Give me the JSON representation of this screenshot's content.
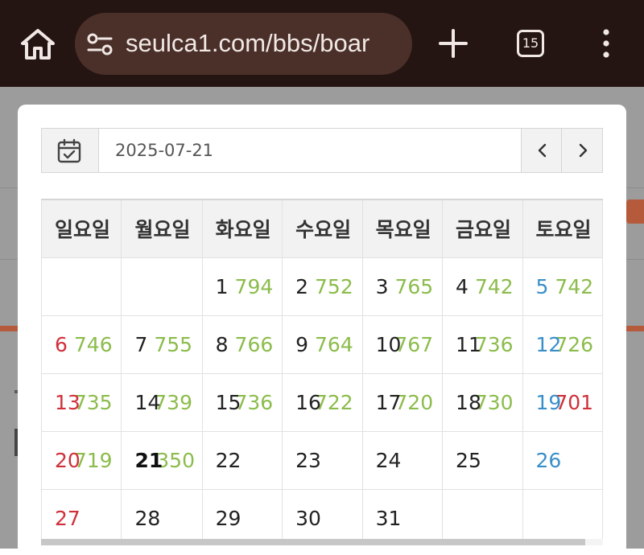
{
  "browser": {
    "url": "seulca1.com/bbs/boar",
    "tab_count": "15",
    "icons": {
      "home": "home-icon",
      "site_info": "site-info-icon",
      "new_tab": "plus-icon",
      "menu": "more-vertical-icon"
    },
    "colors": {
      "bar_bg": "#251512",
      "url_bg": "#4b302a",
      "fg": "#f1e8e5"
    }
  },
  "picker": {
    "date_value": "2025-07-21",
    "icons": {
      "calendar": "calendar-check-icon",
      "prev": "chevron-left-icon",
      "next": "chevron-right-icon"
    }
  },
  "calendar": {
    "weekdays": [
      "일요일",
      "월요일",
      "화요일",
      "수요일",
      "목요일",
      "금요일",
      "토요일"
    ],
    "weeks": [
      [
        {
          "day": "",
          "value": ""
        },
        {
          "day": "",
          "value": ""
        },
        {
          "day": "1",
          "value": "794"
        },
        {
          "day": "2",
          "value": "752"
        },
        {
          "day": "3",
          "value": "765"
        },
        {
          "day": "4",
          "value": "742"
        },
        {
          "day": "5",
          "value": "742"
        }
      ],
      [
        {
          "day": "6",
          "value": "746"
        },
        {
          "day": "7",
          "value": "755"
        },
        {
          "day": "8",
          "value": "766"
        },
        {
          "day": "9",
          "value": "764"
        },
        {
          "day": "10",
          "value": "767"
        },
        {
          "day": "11",
          "value": "736"
        },
        {
          "day": "12",
          "value": "726"
        }
      ],
      [
        {
          "day": "13",
          "value": "735"
        },
        {
          "day": "14",
          "value": "739"
        },
        {
          "day": "15",
          "value": "736"
        },
        {
          "day": "16",
          "value": "722"
        },
        {
          "day": "17",
          "value": "720"
        },
        {
          "day": "18",
          "value": "730"
        },
        {
          "day": "19",
          "value": "701"
        }
      ],
      [
        {
          "day": "20",
          "value": "719"
        },
        {
          "day": "21",
          "value": "350"
        },
        {
          "day": "22",
          "value": ""
        },
        {
          "day": "23",
          "value": ""
        },
        {
          "day": "24",
          "value": ""
        },
        {
          "day": "25",
          "value": ""
        },
        {
          "day": "26",
          "value": ""
        }
      ],
      [
        {
          "day": "27",
          "value": ""
        },
        {
          "day": "28",
          "value": ""
        },
        {
          "day": "29",
          "value": ""
        },
        {
          "day": "30",
          "value": ""
        },
        {
          "day": "31",
          "value": ""
        },
        {
          "day": "",
          "value": ""
        },
        {
          "day": "",
          "value": ""
        }
      ]
    ],
    "today_day": "21",
    "colors": {
      "sunday": "#d0303a",
      "saturday": "#3a8fc8",
      "value": "#8cbc4c",
      "value_alt_red": "#d0303a",
      "header_bg": "#f2f2f2"
    }
  }
}
